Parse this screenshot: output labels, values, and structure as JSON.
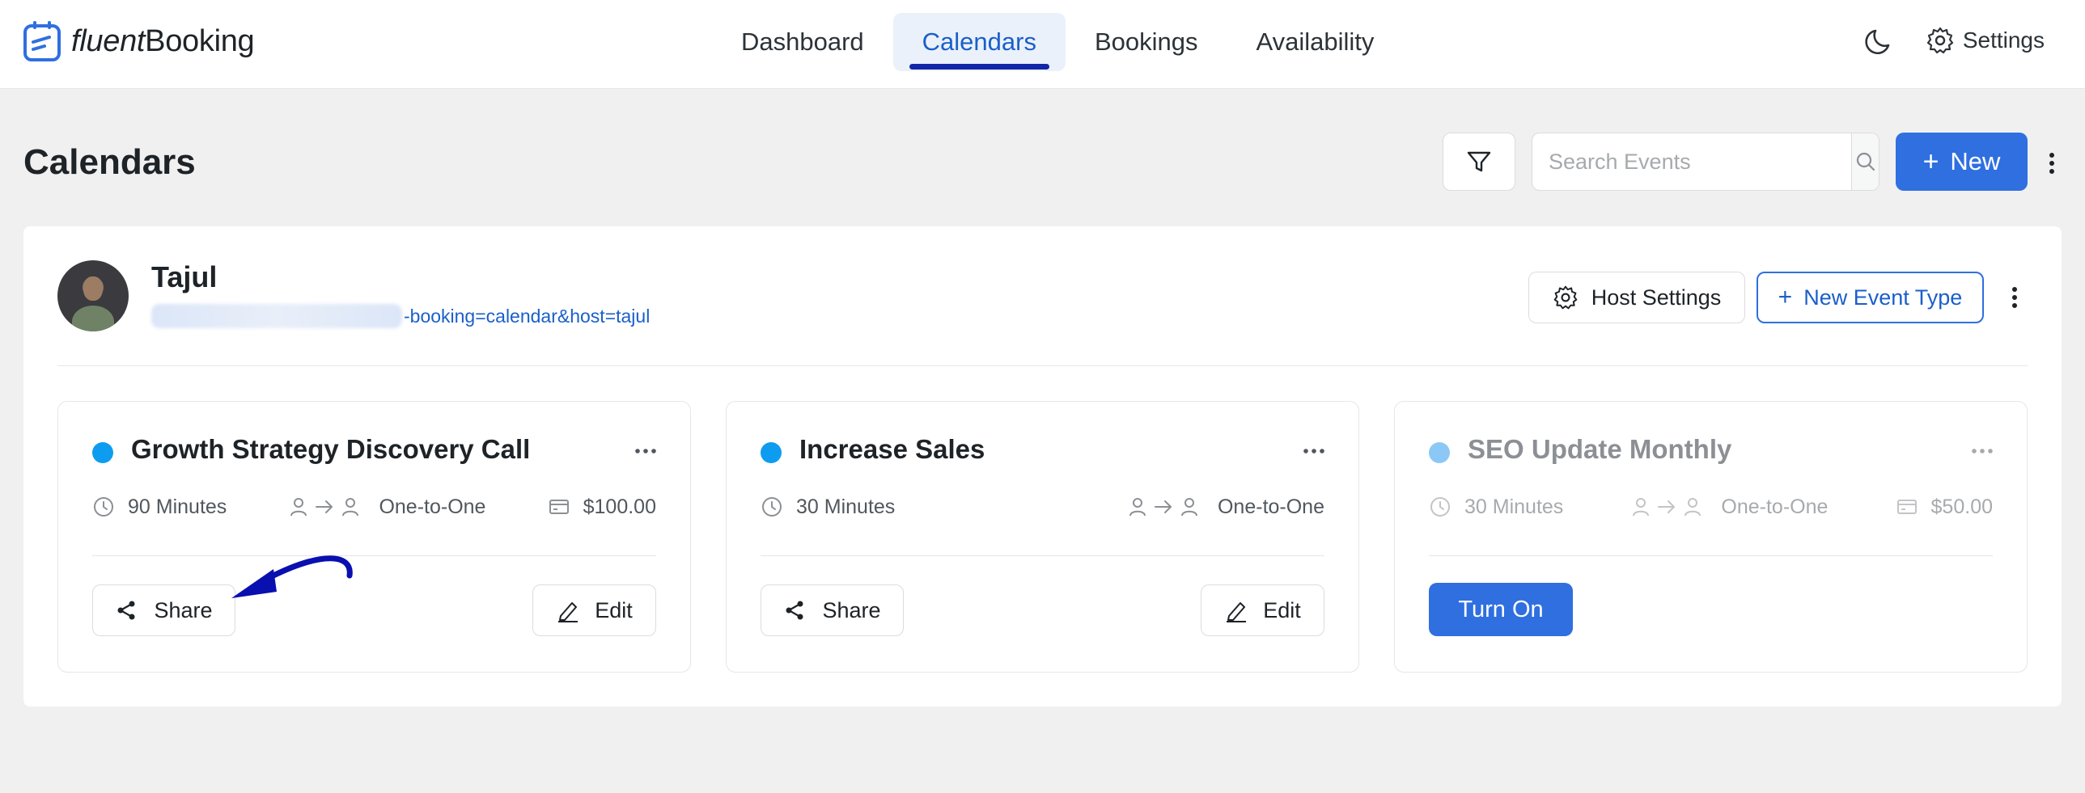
{
  "app": {
    "logo_part1": "fluent",
    "logo_part2": "Booking"
  },
  "nav": {
    "items": [
      {
        "label": "Dashboard",
        "active": false
      },
      {
        "label": "Calendars",
        "active": true
      },
      {
        "label": "Bookings",
        "active": false
      },
      {
        "label": "Availability",
        "active": false
      }
    ],
    "settings_label": "Settings"
  },
  "page": {
    "title": "Calendars",
    "search_placeholder": "Search Events",
    "new_button_label": "New"
  },
  "host": {
    "name": "Tajul",
    "url_visible": "-booking=calendar&host=tajul",
    "host_settings_label": "Host Settings",
    "new_event_type_label": "New Event Type"
  },
  "events": [
    {
      "title": "Growth Strategy Discovery Call",
      "dot_color": "#0e9cf0",
      "duration": "90 Minutes",
      "type": "One-to-One",
      "price": "$100.00",
      "share_label": "Share",
      "edit_label": "Edit",
      "enabled": true
    },
    {
      "title": "Increase Sales",
      "dot_color": "#0e9cf0",
      "duration": "30 Minutes",
      "type": "One-to-One",
      "price": "",
      "share_label": "Share",
      "edit_label": "Edit",
      "enabled": true
    },
    {
      "title": "SEO Update Monthly",
      "dot_color": "#8cc8f6",
      "duration": "30 Minutes",
      "type": "One-to-One",
      "price": "$50.00",
      "turn_on_label": "Turn On",
      "enabled": false
    }
  ],
  "colors": {
    "accent": "#2f6fe0",
    "nav_active_text": "#1a5fc9",
    "nav_underline": "#1227a8",
    "annotation_arrow": "#0a0fb0"
  }
}
